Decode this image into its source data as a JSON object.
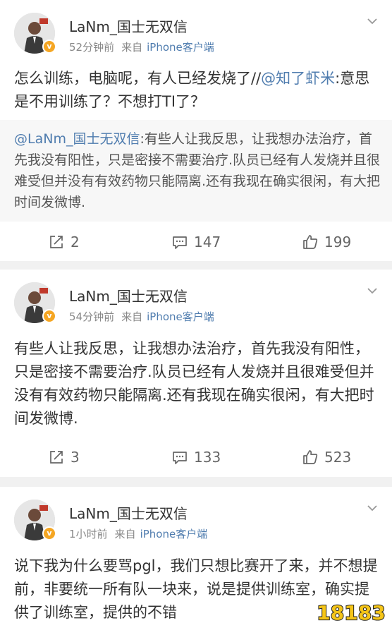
{
  "posts": [
    {
      "username": "LaNm_国士无双信",
      "time": "52分钟前",
      "source_prefix": "来自",
      "client": "iPhone客户端",
      "text_before_mention": "怎么训练，电脑呢，有人已经发烧了//",
      "mention": "@知了虾米",
      "text_after_mention": ":意思是不用训练了？不想打TI了？",
      "repost": {
        "mention": "@LaNm_国士无双信",
        "text": ":有些人让我反思，让我想办法治疗，首先我没有阳性，只是密接不需要治疗.队员已经有人发烧并且很难受但并没有有效药物只能隔离.还有我现在确实很闲，有大把时间发微博."
      },
      "reposts": "2",
      "comments": "147",
      "likes": "199"
    },
    {
      "username": "LaNm_国士无双信",
      "time": "54分钟前",
      "source_prefix": "来自",
      "client": "iPhone客户端",
      "text": "有些人让我反思，让我想办法治疗，首先我没有阳性，只是密接不需要治疗.队员已经有人发烧并且很难受但并没有有效药物只能隔离.还有我现在确实很闲，有大把时间发微博.",
      "reposts": "3",
      "comments": "133",
      "likes": "523"
    },
    {
      "username": "LaNm_国士无双信",
      "time": "1小时前",
      "source_prefix": "来自",
      "client": "iPhone客户端",
      "text": "说下我为什么要骂pgl，我们只想比赛开了来，并不想提前，非要统一所有队一块来，说是提供训练室，确实提供了训练室，提供的不错"
    }
  ],
  "watermark": "18183",
  "colors": {
    "link": "#507daf",
    "verified": "#f5a623",
    "divider": "#f1f1f1"
  },
  "icons": [
    "repost-icon",
    "comment-icon",
    "like-icon",
    "chevron-down-icon",
    "verified-icon"
  ]
}
